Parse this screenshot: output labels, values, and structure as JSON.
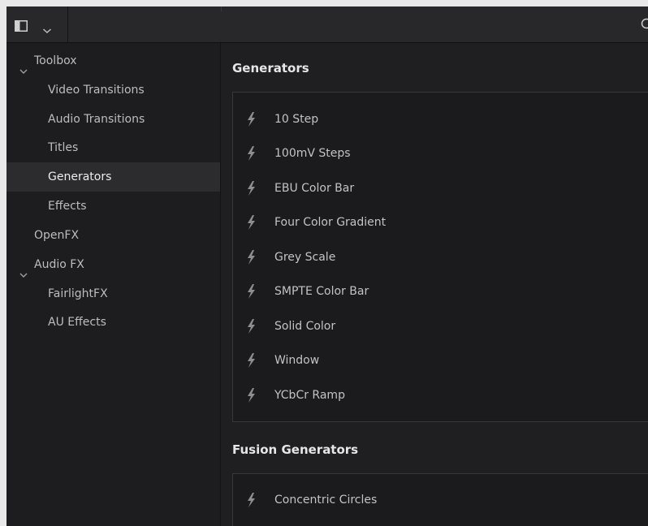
{
  "toolbar": {
    "panel_icon": "sidebar-panel-icon",
    "dropdown_icon": "chevron-down-icon",
    "search_icon": "search-icon"
  },
  "sidebar": {
    "items": [
      {
        "label": "Toolbox",
        "level": 0,
        "expanded": true
      },
      {
        "label": "Video Transitions",
        "level": 1
      },
      {
        "label": "Audio Transitions",
        "level": 1
      },
      {
        "label": "Titles",
        "level": 1
      },
      {
        "label": "Generators",
        "level": 1,
        "selected": true
      },
      {
        "label": "Effects",
        "level": 1
      },
      {
        "label": "OpenFX",
        "level": 0
      },
      {
        "label": "Audio FX",
        "level": 0,
        "expanded": true
      },
      {
        "label": "FairlightFX",
        "level": 1
      },
      {
        "label": "AU Effects",
        "level": 1
      }
    ]
  },
  "main": {
    "generators": {
      "title": "Generators",
      "items": [
        "10 Step",
        "100mV Steps",
        "EBU Color Bar",
        "Four Color Gradient",
        "Grey Scale",
        "SMPTE Color Bar",
        "Solid Color",
        "Window",
        "YCbCr Ramp"
      ]
    },
    "fusion_generators": {
      "title": "Fusion Generators",
      "items": [
        "Concentric Circles"
      ]
    }
  },
  "colors": {
    "background": "#1f1f21",
    "sidebar": "#1d1d1f",
    "selected_row": "#2c2c2f",
    "text": "#c3c3c6"
  }
}
